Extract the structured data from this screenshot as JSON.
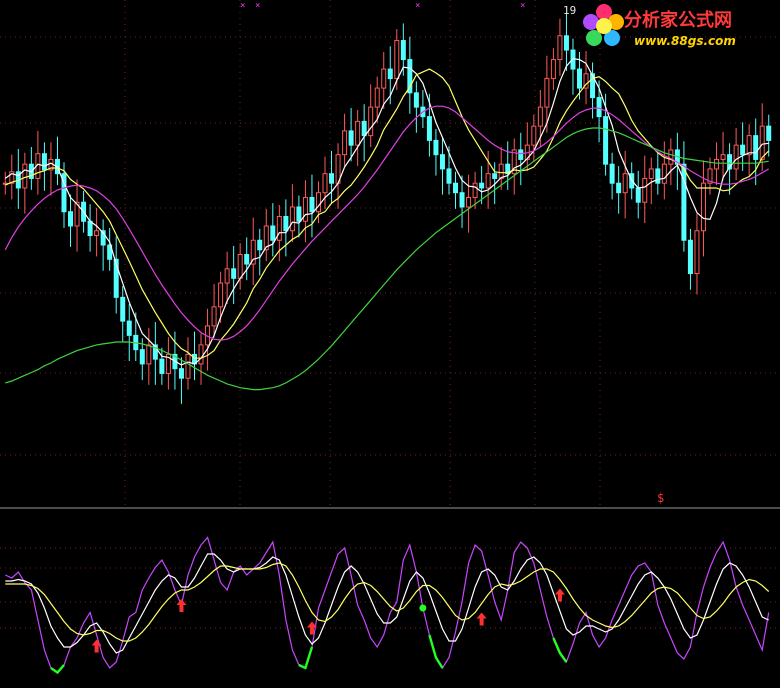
{
  "logo": {
    "title": "分析家公式网",
    "url": "www.88gs.com"
  },
  "annotations": {
    "peak_label": "19",
    "signal_marker": "$"
  },
  "colors": {
    "background": "#000000",
    "up_candle": "#ff5a5a",
    "down_candle": "#54ffff",
    "ma_short": "#ffffff",
    "ma_mid": "#ffff66",
    "ma_long": "#e040e0",
    "ma_longest": "#3fd33f",
    "osc_fast": "#c846ff",
    "osc_mid": "#ffffff",
    "osc_slow": "#ffff66",
    "buy_arrow": "#ff3030",
    "oversold_highlight": "#22ff22",
    "separator": "#9a9a9a",
    "grid": "#7a1f1f"
  },
  "chart_data": [
    {
      "type": "candlestick",
      "name": "price",
      "n_bars": 118,
      "series": [
        {
          "name": "close",
          "values": [
            27.0,
            28.2,
            26.5,
            29.0,
            27.5,
            30.1,
            28.4,
            29.5,
            28.0,
            24.0,
            22.5,
            25.0,
            23.0,
            21.5,
            22.0,
            20.5,
            19.0,
            15.0,
            12.5,
            11.0,
            9.5,
            8.0,
            10.0,
            8.5,
            7.0,
            9.0,
            7.5,
            6.5,
            9.0,
            8.0,
            10.0,
            12.0,
            14.0,
            16.5,
            18.0,
            17.0,
            19.5,
            18.5,
            21.0,
            20.0,
            22.5,
            21.0,
            23.5,
            22.0,
            24.5,
            23.0,
            25.5,
            24.0,
            26.0,
            28.0,
            27.0,
            30.0,
            32.5,
            31.0,
            33.5,
            32.0,
            35.0,
            37.0,
            39.0,
            38.0,
            42.0,
            40.0,
            36.5,
            35.0,
            34.0,
            31.5,
            30.0,
            28.5,
            27.0,
            26.0,
            24.5,
            25.5,
            27.0,
            26.5,
            28.0,
            27.5,
            29.0,
            28.0,
            30.5,
            29.5,
            31.0,
            33.0,
            35.0,
            38.0,
            40.0,
            42.5,
            41.0,
            39.0,
            37.0,
            38.5,
            36.0,
            34.0,
            29.0,
            27.0,
            26.0,
            28.0,
            26.5,
            25.0,
            27.5,
            28.5,
            27.0,
            29.0,
            30.5,
            29.0,
            21.0,
            17.5,
            22.0,
            27.0,
            28.5,
            29.5,
            30.0,
            28.5,
            31.0,
            30.0,
            32.0,
            29.5,
            33.0,
            31.5
          ]
        },
        {
          "name": "MA5",
          "values": [
            27.5,
            28.0,
            27.8,
            28.4,
            28.2,
            29.0,
            28.8,
            29.1,
            28.7,
            27.0,
            25.5,
            24.8,
            24.0,
            23.0,
            22.5,
            21.8,
            20.8,
            18.5,
            16.5,
            14.5,
            12.8,
            11.2,
            10.5,
            9.8,
            8.8,
            8.7,
            8.3,
            7.9,
            8.2,
            8.0,
            8.6,
            9.6,
            11.0,
            12.9,
            14.6,
            15.9,
            17.0,
            17.9,
            19.0,
            19.2,
            20.3,
            20.6,
            21.8,
            21.8,
            22.9,
            22.8,
            23.7,
            23.8,
            24.6,
            25.5,
            26.1,
            27.0,
            28.7,
            29.7,
            30.8,
            31.9,
            32.8,
            33.7,
            35.3,
            36.2,
            37.8,
            39.2,
            39.1,
            38.5,
            37.5,
            35.5,
            33.4,
            31.8,
            30.2,
            28.6,
            27.3,
            26.7,
            26.6,
            26.1,
            26.3,
            26.9,
            27.6,
            27.8,
            28.6,
            28.9,
            29.6,
            30.4,
            31.8,
            33.3,
            35.4,
            37.7,
            39.3,
            40.1,
            40.0,
            39.6,
            38.3,
            37.0,
            35.0,
            33.1,
            30.4,
            28.8,
            27.3,
            26.5,
            26.6,
            27.1,
            27.4,
            27.5,
            28.3,
            28.9,
            27.3,
            25.5,
            23.9,
            23.3,
            23.2,
            24.9,
            27.6,
            28.7,
            29.5,
            29.9,
            30.2,
            30.2,
            31.1,
            31.2
          ]
        },
        {
          "name": "MA10",
          "values": [
            26.8,
            27.1,
            27.3,
            27.6,
            27.8,
            28.1,
            28.3,
            28.6,
            28.6,
            28.3,
            27.4,
            26.9,
            26.4,
            25.6,
            24.8,
            24.0,
            23.0,
            21.6,
            20.2,
            18.8,
            17.3,
            15.8,
            14.6,
            13.4,
            12.3,
            11.2,
            10.3,
            9.6,
            9.2,
            8.6,
            8.6,
            8.9,
            9.4,
            10.5,
            11.3,
            12.2,
            13.3,
            14.4,
            15.9,
            16.9,
            18.1,
            19.0,
            19.9,
            20.5,
            21.1,
            21.5,
            22.3,
            22.7,
            23.7,
            24.0,
            24.9,
            25.4,
            26.2,
            26.8,
            27.7,
            28.7,
            29.8,
            31.0,
            32.6,
            33.7,
            34.8,
            36.1,
            37.1,
            38.4,
            38.7,
            39.0,
            38.6,
            38.1,
            37.2,
            35.6,
            34.0,
            32.6,
            31.5,
            30.4,
            29.3,
            28.2,
            28.1,
            28.1,
            28.4,
            28.3,
            28.4,
            28.7,
            29.5,
            30.4,
            31.8,
            33.4,
            34.6,
            35.6,
            36.5,
            37.4,
            38.0,
            38.2,
            37.7,
            37.0,
            36.4,
            35.1,
            33.6,
            32.5,
            31.7,
            30.9,
            30.2,
            29.7,
            29.5,
            29.2,
            28.5,
            27.3,
            26.5,
            26.5,
            26.5,
            26.5,
            26.2,
            26.3,
            26.9,
            27.4,
            27.7,
            28.4,
            29.7,
            30.4
          ]
        },
        {
          "name": "MA20",
          "values": [
            20.0,
            21.3,
            22.4,
            23.3,
            24.1,
            24.8,
            25.4,
            25.9,
            26.3,
            26.5,
            26.7,
            26.8,
            26.7,
            26.5,
            26.2,
            25.7,
            25.1,
            24.3,
            23.3,
            22.2,
            21.0,
            19.8,
            18.6,
            17.4,
            16.3,
            15.3,
            14.3,
            13.4,
            12.6,
            11.9,
            11.3,
            10.9,
            10.6,
            10.5,
            10.6,
            10.9,
            11.4,
            12.0,
            12.8,
            13.7,
            14.7,
            15.7,
            16.7,
            17.6,
            18.5,
            19.3,
            20.1,
            20.9,
            21.6,
            22.3,
            23.0,
            23.7,
            24.4,
            25.1,
            25.8,
            26.6,
            27.5,
            28.4,
            29.4,
            30.4,
            31.4,
            32.4,
            33.2,
            33.9,
            34.5,
            34.9,
            35.1,
            35.1,
            34.9,
            34.5,
            33.9,
            33.3,
            32.7,
            32.1,
            31.5,
            31.0,
            30.6,
            30.3,
            30.2,
            30.1,
            30.2,
            30.4,
            30.8,
            31.3,
            31.9,
            32.6,
            33.3,
            33.9,
            34.4,
            34.7,
            34.9,
            34.9,
            34.6,
            34.2,
            33.7,
            33.1,
            32.5,
            31.9,
            31.3,
            30.8,
            30.3,
            29.9,
            29.6,
            29.2,
            28.8,
            28.3,
            27.9,
            27.5,
            27.2,
            27.0,
            26.9,
            26.9,
            27.0,
            27.2,
            27.4,
            27.7,
            28.1,
            28.5
          ]
        },
        {
          "name": "MA60",
          "values": [
            6.0,
            6.2,
            6.5,
            6.8,
            7.1,
            7.4,
            7.8,
            8.1,
            8.5,
            8.8,
            9.1,
            9.4,
            9.6,
            9.8,
            10.0,
            10.1,
            10.2,
            10.3,
            10.3,
            10.3,
            10.2,
            10.1,
            9.9,
            9.7,
            9.4,
            9.1,
            8.8,
            8.4,
            8.0,
            7.6,
            7.2,
            6.8,
            6.5,
            6.2,
            5.9,
            5.7,
            5.5,
            5.4,
            5.3,
            5.3,
            5.4,
            5.5,
            5.7,
            6.0,
            6.4,
            6.8,
            7.3,
            7.9,
            8.5,
            9.2,
            9.9,
            10.7,
            11.5,
            12.3,
            13.1,
            13.9,
            14.7,
            15.5,
            16.3,
            17.1,
            17.9,
            18.6,
            19.3,
            20.0,
            20.6,
            21.2,
            21.8,
            22.3,
            22.8,
            23.3,
            23.8,
            24.3,
            24.8,
            25.3,
            25.8,
            26.3,
            26.8,
            27.3,
            27.8,
            28.3,
            28.8,
            29.3,
            29.8,
            30.3,
            30.8,
            31.3,
            31.8,
            32.2,
            32.5,
            32.7,
            32.8,
            32.8,
            32.7,
            32.5,
            32.3,
            32.0,
            31.7,
            31.4,
            31.1,
            30.8,
            30.5,
            30.2,
            30.0,
            29.8,
            29.6,
            29.5,
            29.4,
            29.3,
            29.2,
            29.1,
            29.1,
            29.1,
            29.1,
            29.1,
            29.1,
            29.1,
            29.2,
            29.3
          ]
        }
      ],
      "ylim": [
        0,
        45
      ]
    },
    {
      "type": "line",
      "name": "oscillator",
      "n_bars": 118,
      "series": [
        {
          "name": "fast",
          "values": [
            70,
            68,
            72,
            65,
            60,
            40,
            20,
            8,
            5,
            10,
            22,
            28,
            38,
            45,
            30,
            15,
            8,
            12,
            26,
            42,
            45,
            60,
            68,
            75,
            80,
            72,
            60,
            50,
            70,
            82,
            90,
            95,
            80,
            65,
            60,
            72,
            76,
            70,
            74,
            78,
            85,
            92,
            70,
            40,
            20,
            10,
            8,
            22,
            48,
            60,
            72,
            84,
            88,
            70,
            50,
            40,
            28,
            22,
            30,
            45,
            52,
            80,
            90,
            72,
            48,
            30,
            15,
            8,
            15,
            32,
            52,
            78,
            90,
            86,
            70,
            52,
            40,
            60,
            85,
            92,
            88,
            78,
            60,
            42,
            28,
            18,
            12,
            24,
            38,
            45,
            30,
            22,
            28,
            40,
            50,
            60,
            70,
            76,
            78,
            72,
            50,
            38,
            28,
            18,
            14,
            22,
            45,
            62,
            75,
            85,
            92,
            80,
            62,
            50,
            40,
            30,
            20,
            45
          ]
        },
        {
          "name": "mid",
          "values": [
            66,
            66,
            67,
            66,
            64,
            58,
            48,
            36,
            28,
            22,
            22,
            25,
            30,
            36,
            38,
            32,
            24,
            18,
            20,
            28,
            36,
            44,
            52,
            60,
            66,
            70,
            68,
            62,
            62,
            68,
            76,
            84,
            84,
            80,
            74,
            72,
            74,
            74,
            74,
            75,
            78,
            82,
            80,
            70,
            56,
            42,
            30,
            24,
            28,
            38,
            50,
            62,
            72,
            76,
            72,
            64,
            54,
            44,
            38,
            38,
            42,
            54,
            66,
            72,
            68,
            58,
            46,
            34,
            26,
            26,
            34,
            48,
            62,
            72,
            74,
            70,
            62,
            60,
            66,
            74,
            80,
            82,
            78,
            70,
            58,
            46,
            34,
            30,
            32,
            36,
            36,
            34,
            32,
            34,
            40,
            48,
            56,
            64,
            70,
            72,
            68,
            62,
            54,
            44,
            34,
            28,
            30,
            40,
            52,
            64,
            74,
            78,
            76,
            70,
            62,
            52,
            42,
            40
          ]
        },
        {
          "name": "slow",
          "values": [
            64,
            64,
            64,
            64,
            63,
            61,
            57,
            51,
            45,
            39,
            34,
            31,
            30,
            31,
            33,
            33,
            31,
            28,
            26,
            26,
            28,
            32,
            37,
            43,
            49,
            54,
            58,
            60,
            60,
            62,
            65,
            69,
            73,
            76,
            76,
            75,
            74,
            74,
            74,
            74,
            75,
            77,
            78,
            76,
            70,
            62,
            53,
            45,
            40,
            39,
            42,
            47,
            54,
            60,
            64,
            65,
            63,
            59,
            54,
            49,
            46,
            48,
            53,
            59,
            63,
            63,
            60,
            55,
            49,
            43,
            40,
            41,
            45,
            51,
            57,
            62,
            64,
            63,
            64,
            66,
            69,
            72,
            74,
            74,
            72,
            67,
            61,
            54,
            48,
            43,
            40,
            38,
            36,
            35,
            36,
            39,
            43,
            48,
            53,
            58,
            61,
            62,
            61,
            58,
            53,
            48,
            43,
            41,
            42,
            46,
            51,
            57,
            62,
            65,
            67,
            66,
            63,
            59
          ]
        }
      ],
      "ylim": [
        0,
        100
      ],
      "buy_signals": [
        14,
        27,
        47,
        73,
        85
      ],
      "oversold_spans": [
        [
          7,
          9
        ],
        [
          45,
          47
        ],
        [
          65,
          67
        ],
        [
          84,
          86
        ]
      ],
      "overbought_markers": [
        64
      ]
    }
  ]
}
